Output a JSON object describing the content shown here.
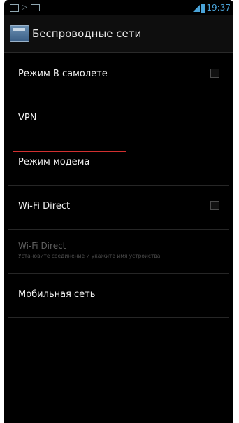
{
  "status_bar": {
    "time": "19:37",
    "accent_color": "#4aa3d8",
    "left_icons": [
      "picture-icon",
      "play-icon",
      "mail-icon"
    ],
    "right_icons": [
      "signal-icon",
      "battery-icon"
    ]
  },
  "action_bar": {
    "title": "Беспроводные сети",
    "icon": "settings-app-icon"
  },
  "settings": {
    "items": [
      {
        "label": "Режим В самолете",
        "has_checkbox": true,
        "checked": false,
        "enabled": true
      },
      {
        "label": "VPN",
        "has_checkbox": false,
        "enabled": true
      },
      {
        "label": "Режим модема",
        "has_checkbox": false,
        "enabled": true,
        "highlighted": true
      },
      {
        "label": "Wi-Fi Direct",
        "has_checkbox": true,
        "checked": false,
        "enabled": true
      },
      {
        "label": "Wi-Fi Direct",
        "summary": "Установите соединение и укажите имя устройства",
        "has_checkbox": false,
        "enabled": false
      },
      {
        "label": "Мобильная сеть",
        "has_checkbox": false,
        "enabled": true
      }
    ]
  },
  "colors": {
    "background": "#000000",
    "text": "#f2f2f2",
    "disabled_text": "#5f5f5f",
    "highlight_border": "#d23030"
  }
}
